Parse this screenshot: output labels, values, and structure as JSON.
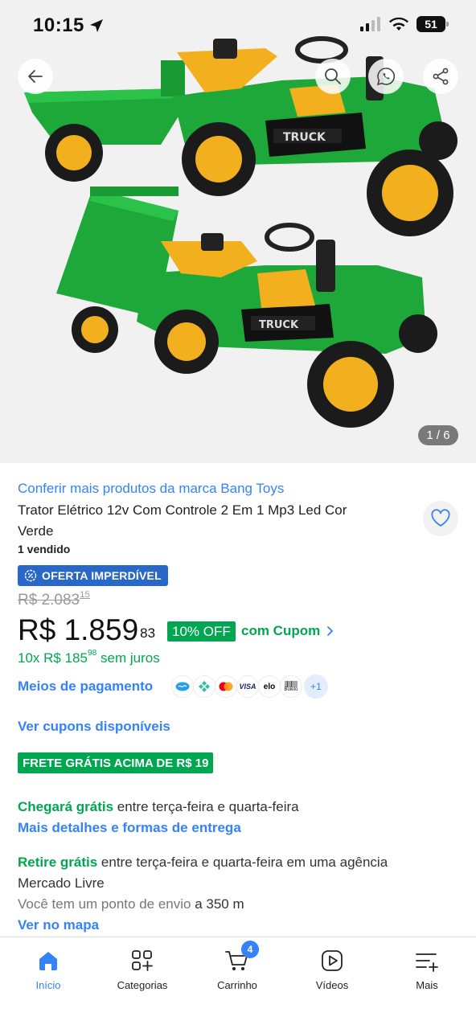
{
  "status": {
    "time": "10:15",
    "battery": "51"
  },
  "gallery": {
    "counter": "1 / 6"
  },
  "product": {
    "brand_link": "Conferir mais produtos da marca Bang Toys",
    "title": "Trator Elétrico 12v Com Controle 2 Em 1 Mp3 Led Cor Verde",
    "sold": "1 vendido",
    "offer_badge": "OFERTA IMPERDÍVEL",
    "old_price_int": "R$ 2.083",
    "old_price_cents": "15",
    "price_int": "R$ 1.859",
    "price_cents": "83",
    "discount": "10% OFF",
    "coupon": "com Cupom",
    "installments_pre": "10x R$ 185",
    "installments_cents": "98",
    "installments_post": " sem juros",
    "payment_link": "Meios de pagamento",
    "payment_icons": [
      "mercado-pago-icon",
      "pix-icon",
      "mastercard-icon",
      "visa-icon",
      "elo-icon",
      "boleto-icon"
    ],
    "payment_visa": "VISA",
    "payment_elo": "elo",
    "payment_boleto": "Boleto",
    "payment_more": "+1",
    "coupons_link": "Ver cupons disponíveis",
    "free_shipping_badge": "FRETE GRÁTIS ACIMA DE R$ 19"
  },
  "shipping": {
    "arrive_label": "Chegará grátis",
    "arrive_text": " entre terça-feira e quarta-feira",
    "details_link": "Mais detalhes e formas de entrega",
    "pickup_label": "Retire grátis",
    "pickup_text": " entre terça-feira e quarta-feira em uma agência",
    "pickup_text2": "Mercado Livre",
    "point_text": "Você tem um ponto de envio",
    "point_distance": " a 350 m",
    "map_link": "Ver no mapa"
  },
  "tabbar": {
    "items": [
      {
        "label": "Início",
        "icon": "home-icon"
      },
      {
        "label": "Categorias",
        "icon": "categories-icon"
      },
      {
        "label": "Carrinho",
        "icon": "cart-icon"
      },
      {
        "label": "Vídeos",
        "icon": "video-icon"
      },
      {
        "label": "Mais",
        "icon": "menu-icon"
      }
    ],
    "cart_count": "4"
  },
  "colors": {
    "accent": "#3483fa",
    "green": "#00a650",
    "offer_blue": "#2968c8"
  }
}
